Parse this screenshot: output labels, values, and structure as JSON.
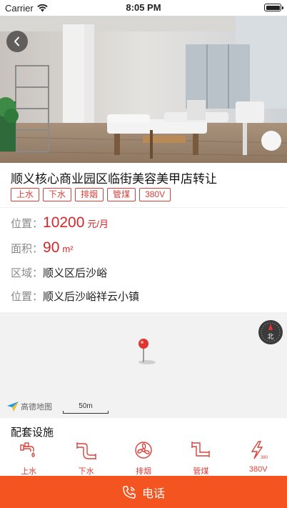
{
  "status_bar": {
    "carrier": "Carrier",
    "time": "8:05 PM"
  },
  "listing": {
    "title": "顺义核心商业园区临街美容美甲店转让",
    "tags": [
      "上水",
      "下水",
      "排烟",
      "管煤",
      "380V"
    ],
    "rent": {
      "label": "位置：",
      "value": "10200",
      "unit": "元/月"
    },
    "area": {
      "label": "面积：",
      "value": "90",
      "unit": "m²"
    },
    "district": {
      "label": "区域：",
      "value": "顺义区后沙峪"
    },
    "location": {
      "label": "位置：",
      "value": "顺义后沙峪祥云小镇"
    }
  },
  "map": {
    "logo_text": "高德地图",
    "scale_text": "50m",
    "compass_text": "北"
  },
  "facilities": {
    "title": "配套设施",
    "items": [
      {
        "label": "上水",
        "icon": "faucet-icon"
      },
      {
        "label": "下水",
        "icon": "drain-pipe-icon"
      },
      {
        "label": "排烟",
        "icon": "exhaust-fan-icon"
      },
      {
        "label": "管煤",
        "icon": "gas-pipe-icon"
      },
      {
        "label": "380V",
        "icon": "voltage-icon"
      }
    ]
  },
  "call_button": {
    "label": "电话"
  },
  "colors": {
    "accent": "#d9403a",
    "price": "#d9252a",
    "call_bar": "#f4541f"
  }
}
